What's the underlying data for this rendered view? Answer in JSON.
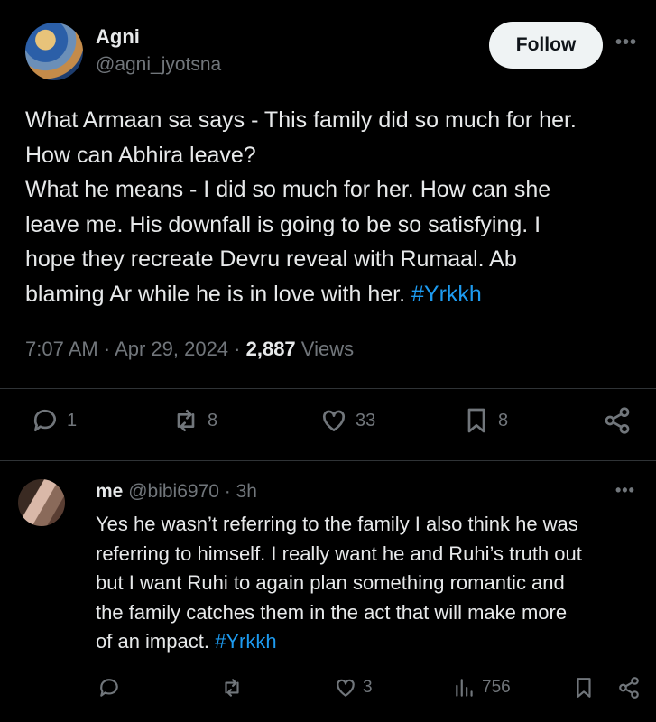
{
  "tweet": {
    "author_name": "Agni",
    "author_handle": "@agni_jyotsna",
    "follow_label": "Follow",
    "more_label": "•••",
    "text_lines": [
      "What Armaan sa says - This family did so much for her.",
      "How can Abhira leave?",
      "What he means - I  did so much for her. How can she",
      "leave me. His downfall is going to be so satisfying. I",
      "hope they recreate Devru reveal with Rumaal. Ab",
      "blaming Ar while he is in love with her. "
    ],
    "hashtag": "#Yrkkh",
    "time": "7:07 AM",
    "date": "Apr 29, 2024",
    "separator": " · ",
    "views_count": "2,887",
    "views_label": "Views",
    "actions": {
      "replies": "1",
      "reposts": "8",
      "likes": "33",
      "bookmarks": "8"
    }
  },
  "reply": {
    "author_name": "me",
    "author_handle": "@bibi6970",
    "time_ago": "3h",
    "separator": " · ",
    "more_label": "•••",
    "text_lines": [
      "Yes he wasn’t referring to the family I also think he was",
      "referring to himself. I really want he and Ruhi’s truth out",
      "but I want Ruhi to again plan something romantic and",
      "the family catches them in the act that will make more",
      "of an impact. "
    ],
    "hashtag": "#Yrkkh",
    "actions": {
      "likes": "3",
      "views": "756"
    }
  },
  "colors": {
    "background": "#000000",
    "text": "#e7e9ea",
    "muted": "#71767b",
    "link": "#1d9bf0",
    "divider": "#2f3336",
    "follow_bg": "#eff3f4"
  }
}
